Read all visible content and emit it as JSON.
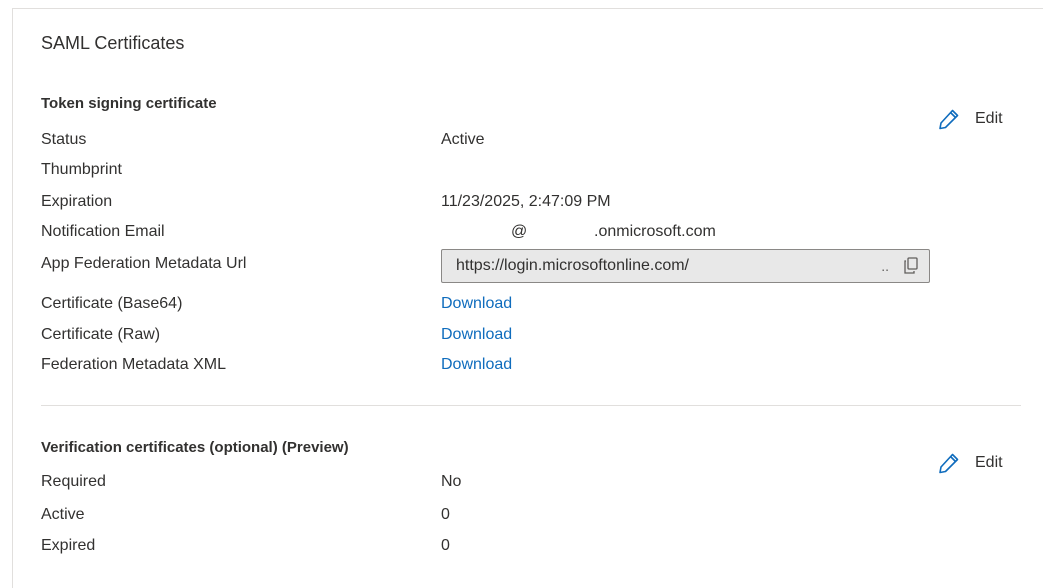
{
  "panel": {
    "title": "SAML Certificates"
  },
  "token_signing": {
    "title": "Token signing certificate",
    "edit_label": "Edit",
    "rows": {
      "status_label": "Status",
      "status_value": "Active",
      "thumbprint_label": "Thumbprint",
      "expiration_label": "Expiration",
      "expiration_value": "11/23/2025, 2:47:09 PM",
      "email_label": "Notification Email",
      "email_at": "@",
      "email_domain": ".onmicrosoft.com",
      "metadata_url_label": "App Federation Metadata Url",
      "metadata_url_value": "https://login.microsoftonline.com/",
      "metadata_url_ellipsis": "..",
      "cert_base64_label": "Certificate (Base64)",
      "cert_raw_label": "Certificate (Raw)",
      "federation_xml_label": "Federation Metadata XML",
      "download_label": "Download"
    }
  },
  "verification": {
    "title": "Verification certificates (optional) (Preview)",
    "edit_label": "Edit",
    "rows": {
      "required_label": "Required",
      "required_value": "No",
      "active_label": "Active",
      "active_value": "0",
      "expired_label": "Expired",
      "expired_value": "0"
    }
  },
  "icons": {
    "edit": "pencil-icon",
    "copy": "copy-icon"
  },
  "colors": {
    "link": "#0f6cbd",
    "pencil": "#0f6cbd"
  }
}
